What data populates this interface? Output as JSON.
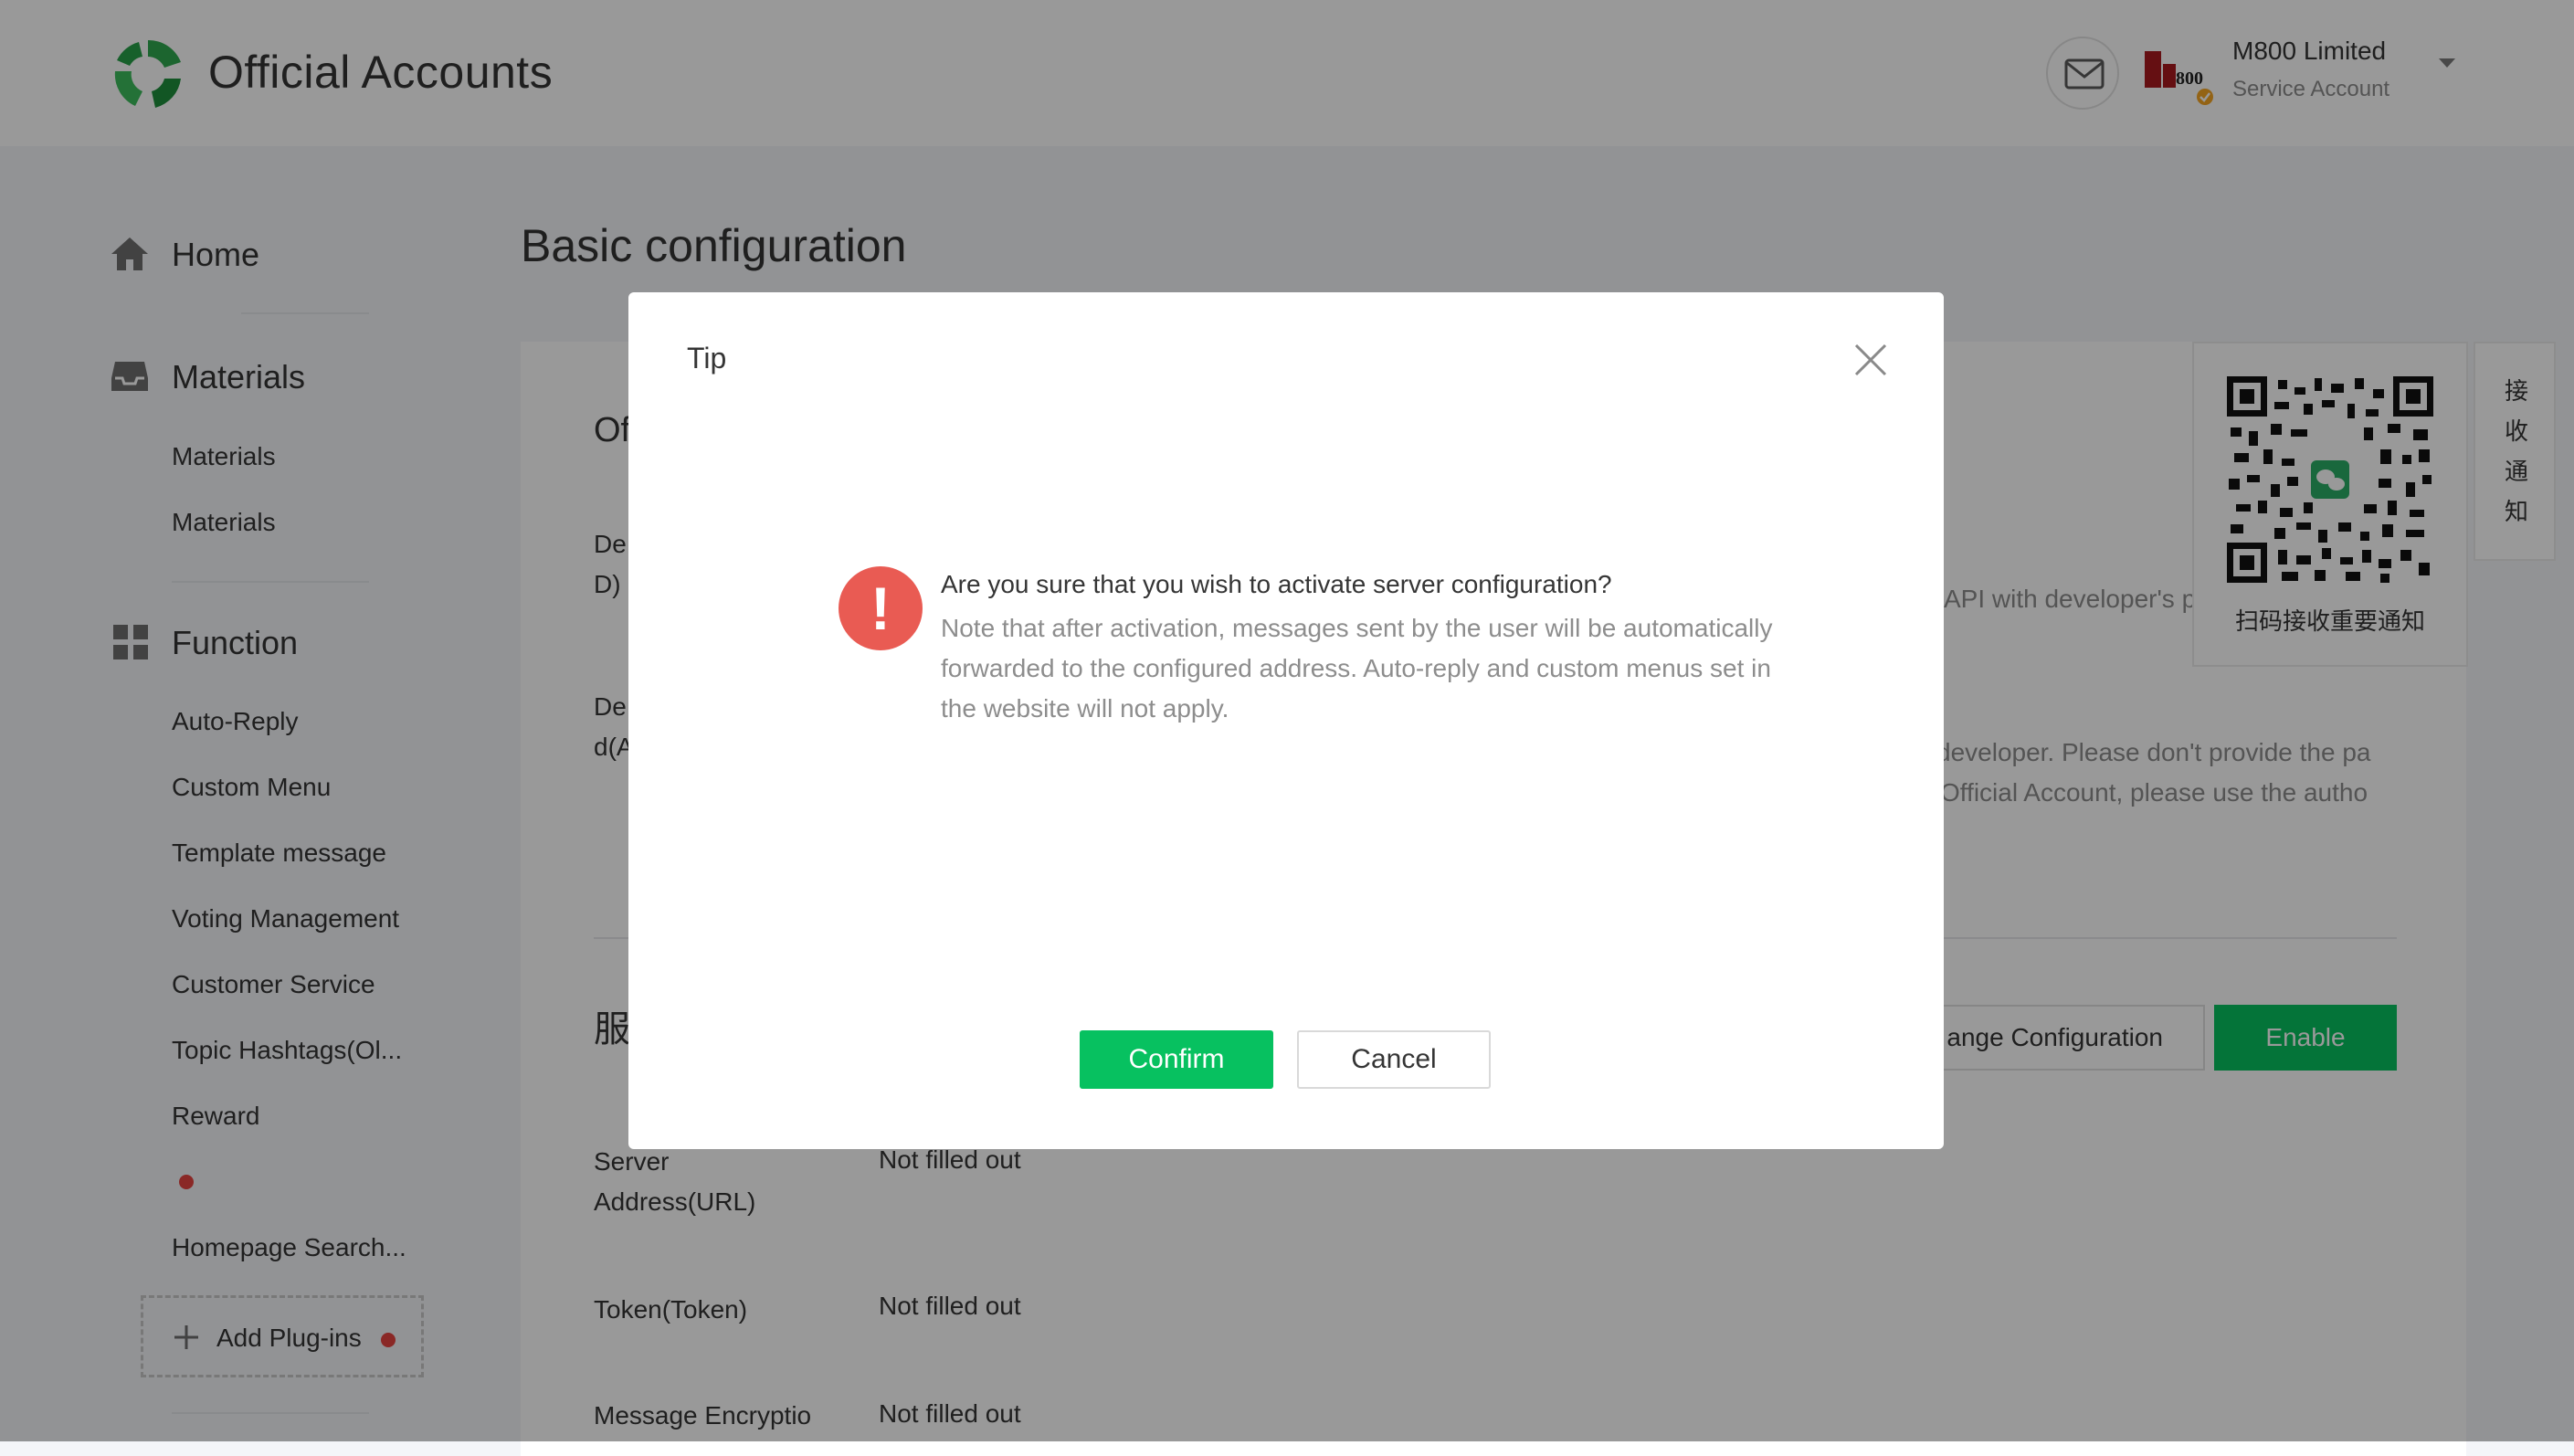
{
  "header": {
    "brand": "Official Accounts",
    "account_name": "M800 Limited",
    "account_type": "Service Account",
    "account_logo_text": "800"
  },
  "sidebar": {
    "home": "Home",
    "materials_group": "Materials",
    "materials_items": [
      "Materials",
      "Materials"
    ],
    "function_group": "Function",
    "function_items": [
      "Auto-Reply",
      "Custom Menu",
      "Template message",
      "Voting Management",
      "Customer Service",
      "Topic Hashtags(Ol...",
      "Reward"
    ],
    "homepage_search": "Homepage Search...",
    "add_plugins": "Add Plug-ins"
  },
  "main": {
    "title": "Basic configuration",
    "section1_partial": "Of",
    "dev_row1_partial": [
      "De",
      "D)"
    ],
    "dev_row2_partial": [
      "De",
      "d(A"
    ],
    "api_text": "API with developer's password",
    "developer_text_line1": "developer. Please don't provide the pa",
    "developer_text_line2": "Official Account, please use the autho",
    "section2_partial": "服",
    "change_config": "ange Configuration",
    "enable": "Enable",
    "server_address_label": "Server Address(URL)",
    "server_address_value": "Not filled out",
    "token_label": "Token(Token)",
    "token_value": "Not filled out",
    "encryption_label": "Message Encryptio",
    "encryption_value": "Not filled out"
  },
  "qr": {
    "caption": "扫码接收重要通知",
    "vertical": [
      "接",
      "收",
      "通",
      "知"
    ]
  },
  "modal": {
    "title": "Tip",
    "question": "Are you sure that you wish to activate server configuration?",
    "description": "Note that after activation, messages sent by the user will be automatically forwarded to the configured address. Auto-reply and custom menus set in the website will not apply.",
    "confirm": "Confirm",
    "cancel": "Cancel"
  },
  "colors": {
    "brand_green": "#07c160",
    "warning_red": "#e95b53",
    "dot_red": "#e64340"
  }
}
